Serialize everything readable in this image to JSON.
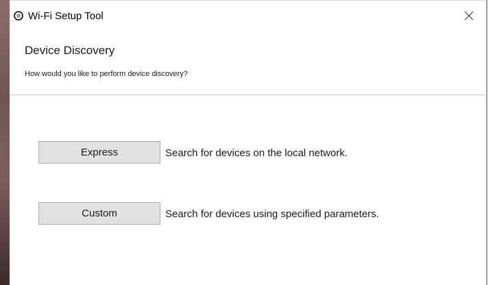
{
  "window": {
    "title": "Wi-Fi Setup Tool",
    "close_glyph": "✕",
    "icon": "app-ring-icon"
  },
  "header": {
    "heading": "Device Discovery",
    "subheading": "How would you like to perform device discovery?"
  },
  "options": [
    {
      "label": "Express",
      "description": "Search for devices on the local network."
    },
    {
      "label": "Custom",
      "description": "Search for devices using specified parameters."
    }
  ],
  "colors": {
    "button_bg": "#e1e1e1",
    "button_border": "#adadad",
    "divider": "#c8c8c8"
  }
}
